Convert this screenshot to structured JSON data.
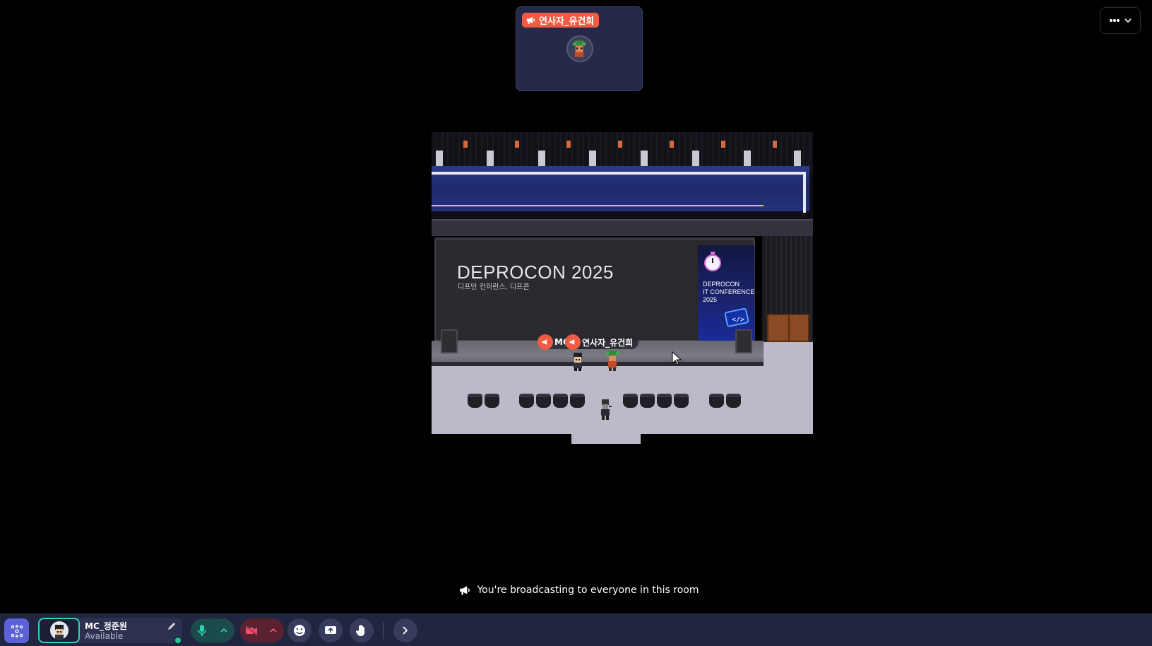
{
  "speaker_card": {
    "tag_label": "연사자_유건희"
  },
  "toolbar_top": {
    "more_icon": "ellipsis-icon",
    "dropdown_icon": "chevron-down-icon"
  },
  "map": {
    "stage_title": "DEPROCON 2025",
    "stage_subtitle": "디프만 컨퍼런스, 디프콘",
    "poster_line1": "DEPROCON",
    "poster_line2": "IT CONFERENCE",
    "poster_line3": "2025",
    "labels": {
      "mc_partial": "MC",
      "speaker": "연사자_유건희"
    }
  },
  "broadcast": {
    "message": "You're broadcasting to everyone in this room",
    "icon": "megaphone-icon"
  },
  "bottom_bar": {
    "user_name": "MC_정준원",
    "user_status": "Available",
    "status_color": "#20c997",
    "accent_color": "#5b62d8"
  },
  "colors": {
    "megaphone_tag": "#f05b41",
    "mic_on": "#2fd1b0",
    "camera_off": "#f0506e"
  }
}
